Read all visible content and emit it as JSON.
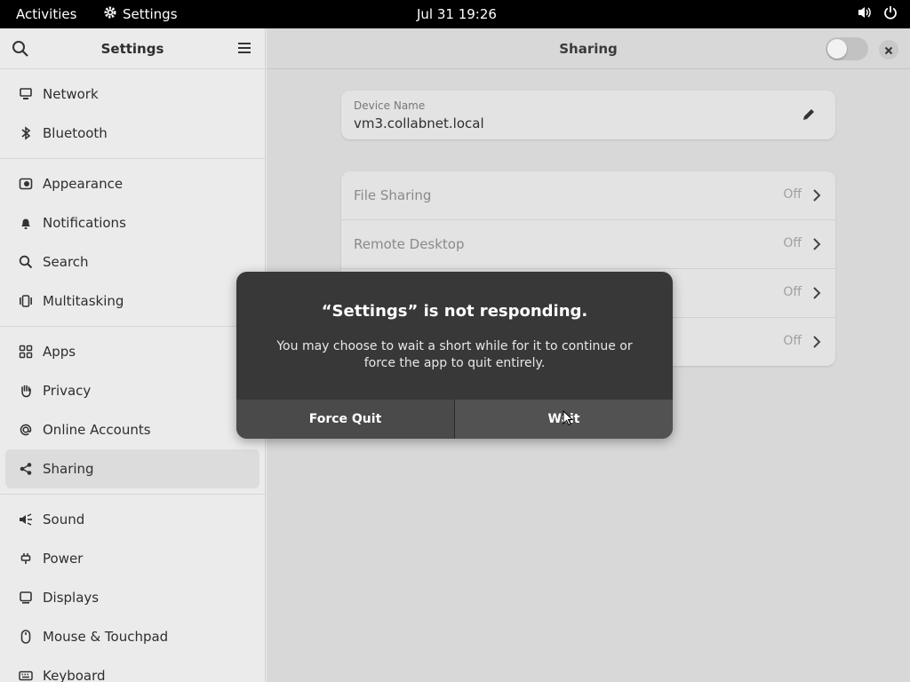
{
  "topbar": {
    "activities": "Activities",
    "app_name": "Settings",
    "clock": "Jul 31  19:26"
  },
  "sidebar": {
    "title": "Settings",
    "groups": [
      [
        {
          "label": "Network",
          "icon": "network-icon"
        },
        {
          "label": "Bluetooth",
          "icon": "bluetooth-icon"
        }
      ],
      [
        {
          "label": "Appearance",
          "icon": "appearance-icon"
        },
        {
          "label": "Notifications",
          "icon": "bell-icon"
        },
        {
          "label": "Search",
          "icon": "search-icon"
        },
        {
          "label": "Multitasking",
          "icon": "multitasking-icon"
        }
      ],
      [
        {
          "label": "Apps",
          "icon": "apps-grid-icon"
        },
        {
          "label": "Privacy",
          "icon": "hand-icon"
        },
        {
          "label": "Online Accounts",
          "icon": "at-icon"
        },
        {
          "label": "Sharing",
          "icon": "share-icon",
          "active": true
        }
      ],
      [
        {
          "label": "Sound",
          "icon": "speaker-icon"
        },
        {
          "label": "Power",
          "icon": "power-plug-icon"
        },
        {
          "label": "Displays",
          "icon": "display-icon"
        },
        {
          "label": "Mouse & Touchpad",
          "icon": "mouse-icon"
        },
        {
          "label": "Keyboard",
          "icon": "keyboard-icon"
        }
      ]
    ]
  },
  "content": {
    "title": "Sharing",
    "device": {
      "label": "Device Name",
      "value": "vm3.collabnet.local"
    },
    "rows": [
      {
        "name": "File Sharing",
        "state": "Off"
      },
      {
        "name": "Remote Desktop",
        "state": "Off"
      },
      {
        "name": "",
        "state": "Off"
      },
      {
        "name": "",
        "state": "Off"
      }
    ]
  },
  "dialog": {
    "heading": "“Settings” is not responding.",
    "body": "You may choose to wait a short while for it to continue or force the app to quit entirely.",
    "force_quit": "Force Quit",
    "wait": "Wait"
  }
}
